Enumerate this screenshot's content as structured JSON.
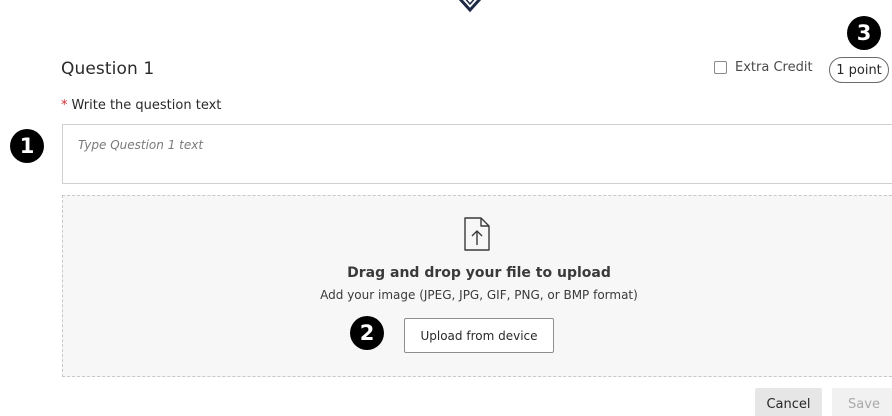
{
  "question": {
    "title": "Question 1",
    "extra_credit_label": "Extra Credit",
    "extra_credit_checked": false,
    "points_label": "1 point",
    "required_marker": "*",
    "field_label": "Write the question text",
    "input_placeholder": "Type Question 1 text",
    "input_value": ""
  },
  "upload": {
    "icon": "file-upload-icon",
    "heading": "Drag and drop your file to upload",
    "subtext": "Add your image (JPEG, JPG, GIF, PNG, or BMP format)",
    "button_label": "Upload from device"
  },
  "callouts": {
    "badge_1": "1",
    "badge_2": "2",
    "badge_3": "3"
  },
  "footer": {
    "cancel_label": "Cancel",
    "save_label": "Save"
  },
  "colors": {
    "required": "#c9302c",
    "badge": "#000000",
    "zone_background": "#f7f7f7",
    "disabled_text": "#a9a9a9"
  }
}
